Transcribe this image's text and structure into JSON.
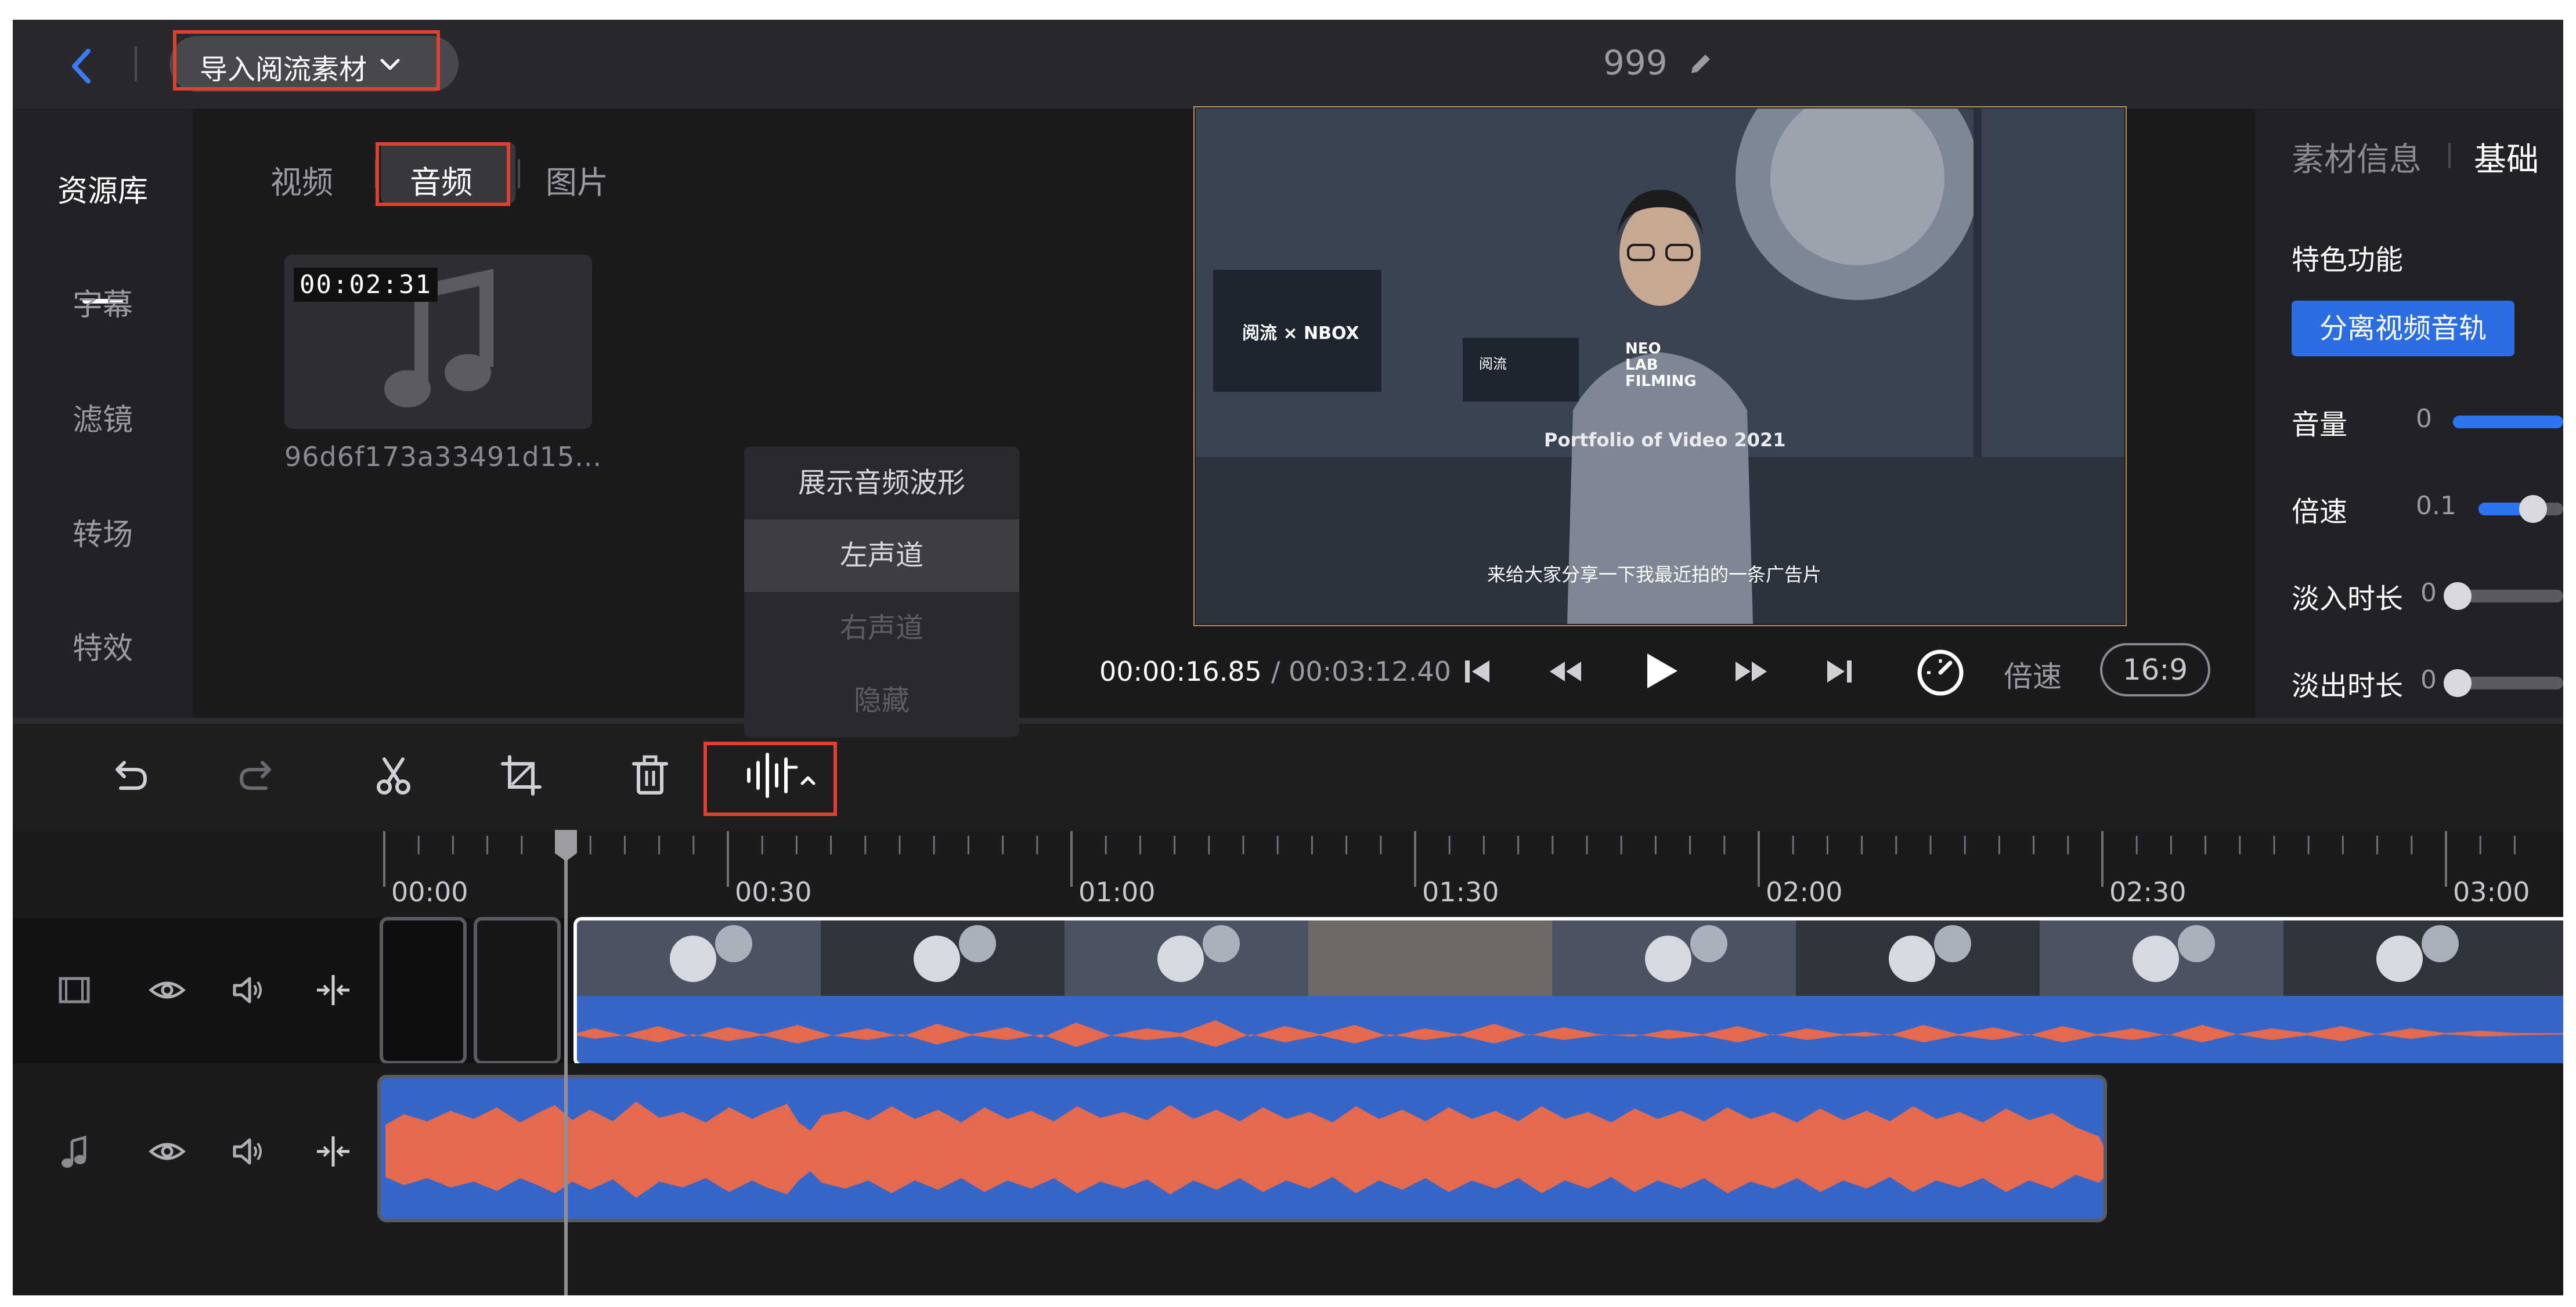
{
  "header": {
    "import_label": "导入阅流素材",
    "project_title": "999"
  },
  "left_nav": {
    "items": [
      {
        "label": "资源库",
        "active": true
      },
      {
        "label": "字幕"
      },
      {
        "label": "滤镜"
      },
      {
        "label": "转场"
      },
      {
        "label": "特效"
      }
    ]
  },
  "resource_panel": {
    "tabs": [
      {
        "label": "视频"
      },
      {
        "label": "音频",
        "active": true
      },
      {
        "label": "图片"
      }
    ],
    "item": {
      "duration": "00:02:31",
      "name": "96d6f173a33491d15..."
    }
  },
  "waveform_menu": {
    "items": [
      {
        "label": "展示音频波形",
        "state": "normal"
      },
      {
        "label": "左声道",
        "state": "selected"
      },
      {
        "label": "右声道",
        "state": "disabled"
      },
      {
        "label": "隐藏",
        "state": "disabled"
      }
    ]
  },
  "preview": {
    "time_current": "00:00:16.85",
    "time_total": "/ 00:03:12.40",
    "speed_label": "倍速",
    "aspect_ratio": "16:9",
    "video_text": {
      "logo_left": "阅流 × NBOX",
      "logo_small": "阅流",
      "brand": "NEO LAB FILMING",
      "portfolio": "Portfolio of Video 2021",
      "subtitle": "来给大家分享一下我最近拍的一条广告片"
    }
  },
  "right_panel": {
    "tab_info": "素材信息",
    "tab_basic": "基础",
    "feature_title": "特色功能",
    "split_button": "分离视频音轨",
    "props": [
      {
        "label": "音量",
        "value": "0",
        "level": 1.0
      },
      {
        "label": "倍速",
        "value": "0.1",
        "level": 0.55
      },
      {
        "label": "淡入时长",
        "value": "0",
        "level": 0.0
      },
      {
        "label": "淡出时长",
        "value": "0",
        "level": 0.0
      }
    ]
  },
  "timeline": {
    "ruler_labels": [
      "00:00",
      "00:30",
      "01:00",
      "01:30",
      "02:00",
      "02:30",
      "03:00"
    ]
  },
  "colors": {
    "accent_blue": "#2b6ee3",
    "highlight_red": "#e0402f",
    "waveform_orange": "#e36a4f",
    "waveform_blue": "#3566c8"
  },
  "icons": [
    "back-icon",
    "chevron-down-icon",
    "edit-pencil-icon",
    "undo-icon",
    "redo-icon",
    "scissors-icon",
    "crop-icon",
    "trash-icon",
    "waveform-icon",
    "film-icon",
    "music-note-icon",
    "eye-icon",
    "speaker-icon",
    "split-icon",
    "skip-start-icon",
    "rewind-icon",
    "play-icon",
    "fast-forward-icon",
    "skip-end-icon",
    "speed-gauge-icon"
  ]
}
